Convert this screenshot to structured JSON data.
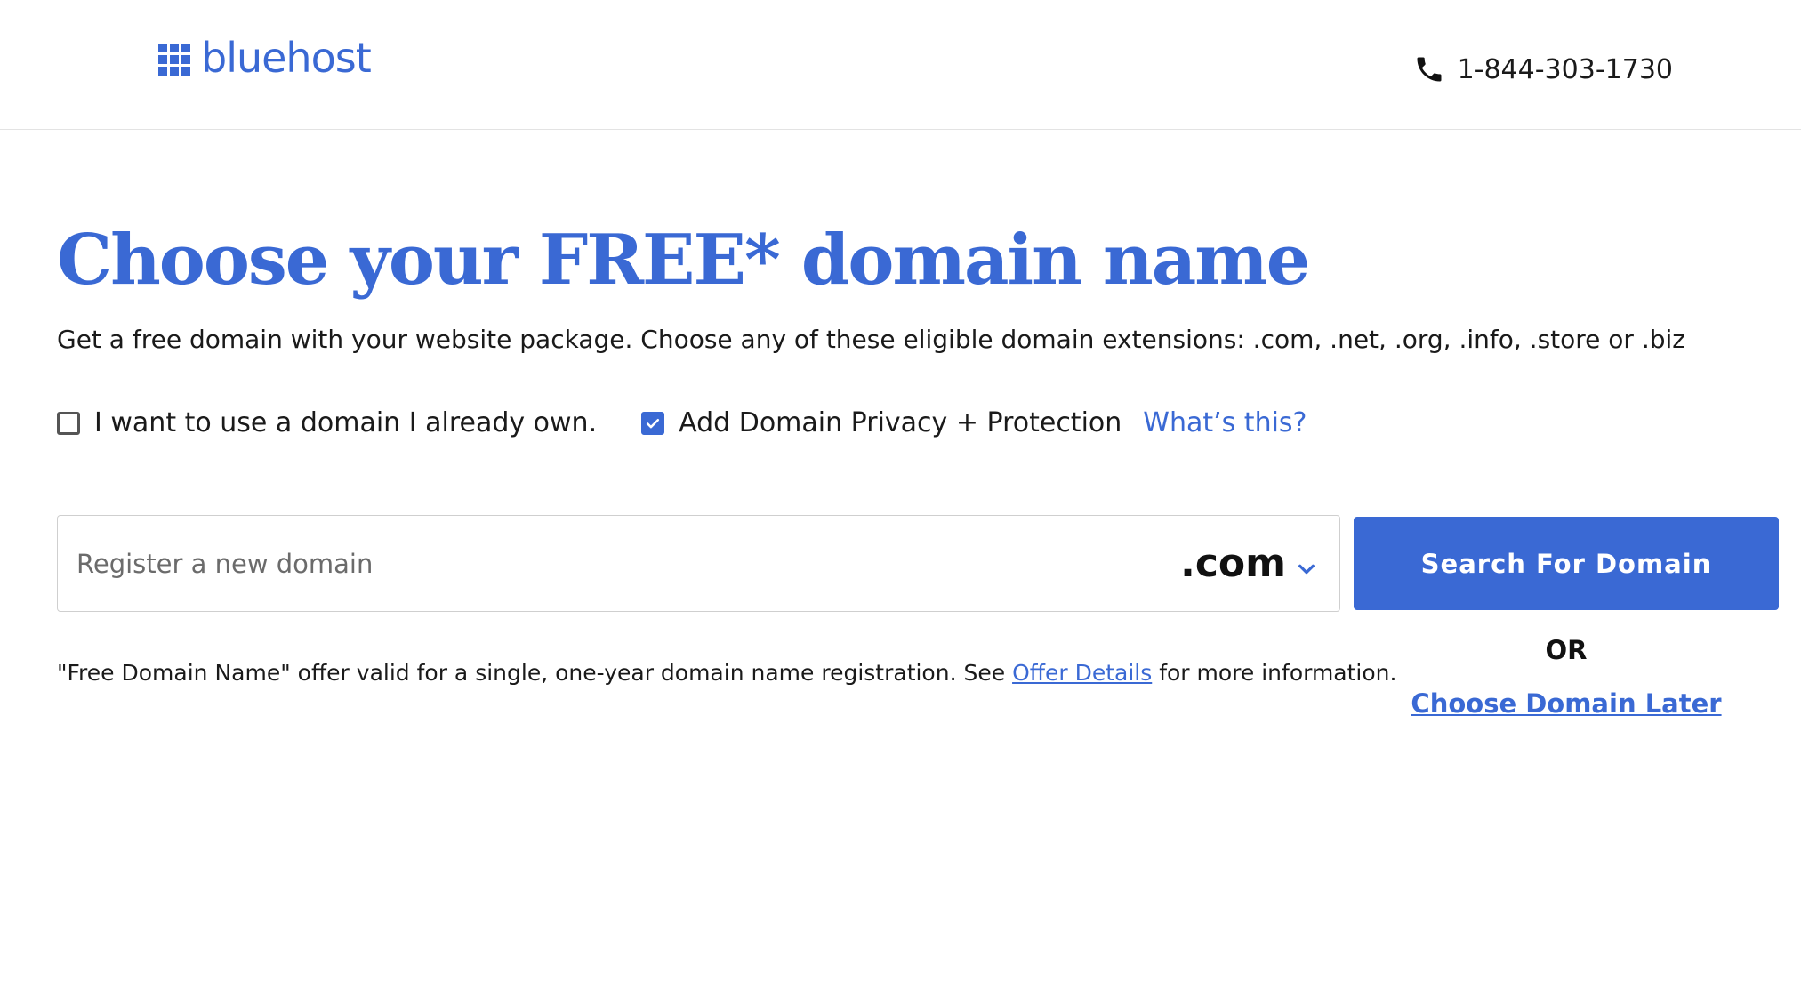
{
  "header": {
    "logo_text": "bluehost",
    "phone_icon": "phone-icon",
    "phone_number": "1-844-303-1730"
  },
  "main": {
    "title": "Choose your FREE* domain name",
    "subtitle": "Get a free domain with your website package. Choose any of these eligible domain extensions: .com, .net, .org, .info, .store or .biz",
    "options": {
      "own_domain": {
        "label": "I want to use a domain I already own.",
        "checked": false
      },
      "privacy": {
        "label": "Add Domain Privacy + Protection",
        "link": "What’s this?",
        "checked": true
      }
    },
    "domain_input": {
      "placeholder": "Register a new domain",
      "value": "",
      "tld_selected": ".com"
    },
    "search_button_label": "Search For Domain",
    "or_label": "OR",
    "choose_later_label": "Choose Domain Later",
    "disclaimer": {
      "before": "\"Free Domain Name\" offer valid for a single, one-year domain name registration. See ",
      "link": "Offer Details",
      "after": " for more information."
    }
  },
  "colors": {
    "brand": "#3a69d4",
    "text": "#1a1a1a",
    "border": "#cfcfcf"
  }
}
